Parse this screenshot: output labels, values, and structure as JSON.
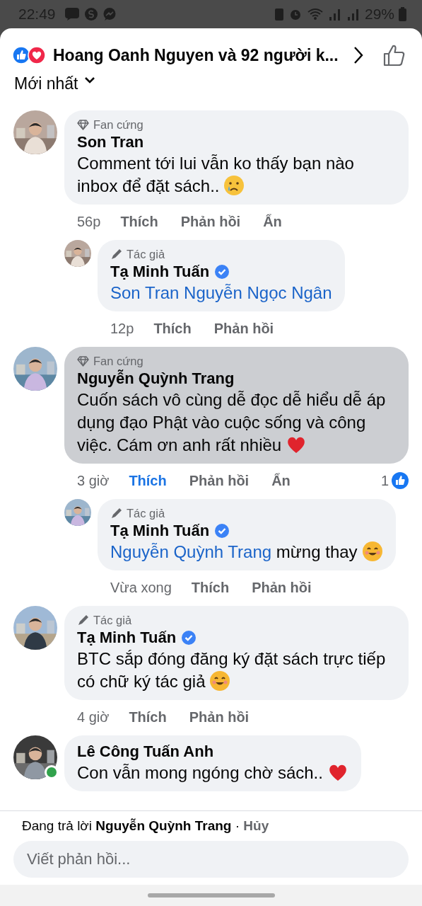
{
  "status_bar": {
    "time": "22:49",
    "battery": "29%"
  },
  "header": {
    "title": "Hoang Oanh Nguyen và 92 người k..."
  },
  "sort": {
    "label": "Mới nhất"
  },
  "comments": [
    {
      "badge": {
        "kind": "fan",
        "label": "Fan cứng"
      },
      "name": "Son Tran",
      "verified": false,
      "highlighted": false,
      "online": false,
      "text": "Comment tới lui vẫn ko thấy bạn nào inbox để đặt sách..",
      "emoji": {
        "kind": "sad"
      },
      "time": "56p",
      "like": {
        "label": "Thích",
        "selected": false
      },
      "reply": "Phản hồi",
      "hide": "Ẩn",
      "children": [
        {
          "badge": {
            "kind": "author",
            "label": "Tác giả"
          },
          "name": "Tạ Minh Tuấn",
          "verified": true,
          "highlighted": false,
          "online": false,
          "mention": "Son Tran Nguyễn Ngọc Ngân",
          "time": "12p",
          "like": {
            "label": "Thích",
            "selected": false
          },
          "reply": "Phản hồi"
        }
      ]
    },
    {
      "badge": {
        "kind": "fan",
        "label": "Fan cứng"
      },
      "name": "Nguyễn Quỳnh Trang",
      "verified": false,
      "highlighted": true,
      "online": false,
      "text": "Cuốn sách vô cùng dễ đọc dễ hiểu dễ áp dụng đạo Phật vào cuộc sống và công việc. Cám ơn anh rất nhiều",
      "emoji": {
        "kind": "heart"
      },
      "time": "3 giờ",
      "like": {
        "label": "Thích",
        "selected": true
      },
      "reply": "Phản hồi",
      "hide": "Ẩn",
      "reactions": "1",
      "children": [
        {
          "badge": {
            "kind": "author",
            "label": "Tác giả"
          },
          "name": "Tạ Minh Tuấn",
          "verified": true,
          "highlighted": false,
          "online": false,
          "mention": "Nguyễn Quỳnh Trang",
          "text": "mừng thay",
          "emoji": {
            "kind": "smile"
          },
          "time": "Vừa xong",
          "like": {
            "label": "Thích",
            "selected": false
          },
          "reply": "Phản hồi"
        }
      ]
    },
    {
      "badge": {
        "kind": "author",
        "label": "Tác giả"
      },
      "name": "Tạ Minh Tuấn",
      "verified": true,
      "highlighted": false,
      "online": false,
      "text": "BTC sắp đóng đăng ký đặt sách trực tiếp có chữ ký tác giả",
      "emoji": {
        "kind": "smile"
      },
      "time": "4 giờ",
      "like": {
        "label": "Thích",
        "selected": false
      },
      "reply": "Phản hồi"
    },
    {
      "name": "Lê Công Tuấn Anh",
      "verified": false,
      "highlighted": false,
      "online": true,
      "text": "Con vẫn mong ngóng chờ sách..",
      "emoji": {
        "kind": "heart"
      }
    }
  ],
  "composer": {
    "replying_label": "Đang trả lời",
    "replying_name": "Nguyễn Quỳnh Trang",
    "separator": "·",
    "cancel": "Hủy",
    "placeholder": "Viết phản hồi..."
  }
}
